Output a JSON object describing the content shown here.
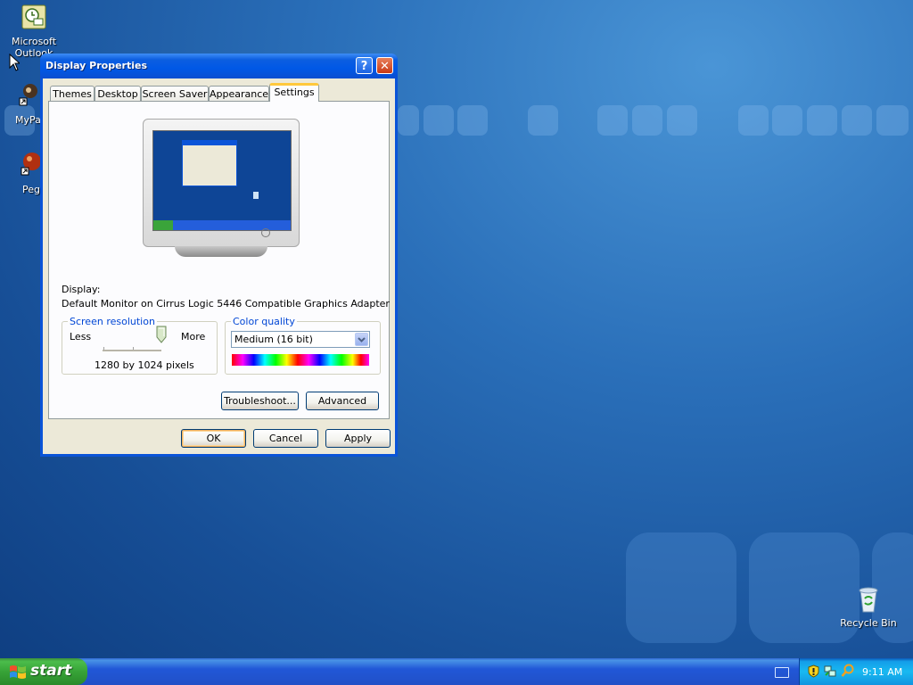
{
  "desktop": {
    "icons": [
      {
        "label": "Microsoft Outlook",
        "icon": "outlook-icon"
      },
      {
        "label": "MyPa",
        "icon": "mypa-shortcut-icon"
      },
      {
        "label": "Peg",
        "icon": "peg-shortcut-icon"
      },
      {
        "label": "Recycle Bin",
        "icon": "recycle-bin-icon"
      }
    ]
  },
  "window": {
    "title": "Display Properties",
    "tabs": [
      "Themes",
      "Desktop",
      "Screen Saver",
      "Appearance",
      "Settings"
    ],
    "active_tab": "Settings",
    "display_label": "Display:",
    "display_value": "Default Monitor on Cirrus Logic 5446 Compatible Graphics Adapter",
    "resolution": {
      "legend": "Screen resolution",
      "less": "Less",
      "more": "More",
      "value": "1280 by 1024 pixels"
    },
    "color_quality": {
      "legend": "Color quality",
      "selected": "Medium (16 bit)"
    },
    "buttons": {
      "troubleshoot": "Troubleshoot...",
      "advanced": "Advanced",
      "ok": "OK",
      "cancel": "Cancel",
      "apply": "Apply"
    }
  },
  "taskbar": {
    "start_label": "start",
    "clock": "9:11 AM"
  }
}
